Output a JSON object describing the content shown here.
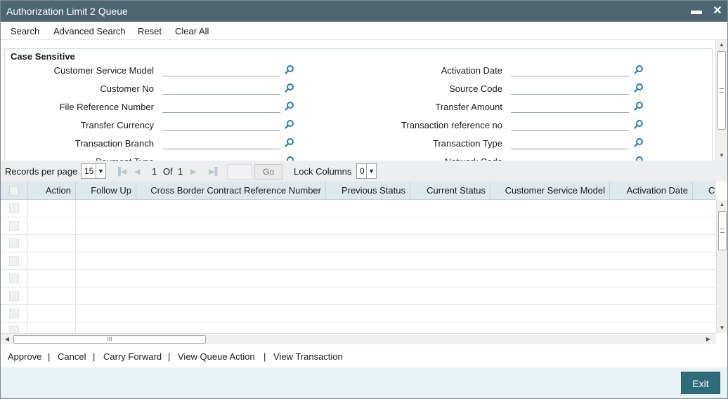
{
  "window": {
    "title": "Authorization Limit 2 Queue",
    "minimize_glyph": "▬",
    "close_glyph": "✕"
  },
  "toolbar": {
    "search": "Search",
    "advanced_search": "Advanced Search",
    "reset": "Reset",
    "clear_all": "Clear All"
  },
  "criteria": {
    "legend": "Case Sensitive",
    "left_fields": [
      {
        "label": "Customer Service Model",
        "value": ""
      },
      {
        "label": "Customer No",
        "value": ""
      },
      {
        "label": "File Reference Number",
        "value": ""
      },
      {
        "label": "Transfer Currency",
        "value": ""
      },
      {
        "label": "Transaction Branch",
        "value": ""
      },
      {
        "label": "Payment Type",
        "value": ""
      }
    ],
    "right_fields": [
      {
        "label": "Activation Date",
        "value": ""
      },
      {
        "label": "Source Code",
        "value": ""
      },
      {
        "label": "Transfer Amount",
        "value": ""
      },
      {
        "label": "Transaction reference no",
        "value": ""
      },
      {
        "label": "Transaction Type",
        "value": ""
      },
      {
        "label": "Network Code",
        "value": ""
      }
    ]
  },
  "pager": {
    "records_per_page_label": "Records per page",
    "records_per_page": "15",
    "current_page": "1",
    "of_label": "Of",
    "total_pages": "1",
    "go_label": "Go",
    "lock_columns_label": "Lock Columns",
    "lock_columns": "0"
  },
  "grid": {
    "columns": [
      "Action",
      "Follow Up",
      "Cross Border Contract Reference Number",
      "Previous Status",
      "Current Status",
      "Customer Service Model",
      "Activation Date",
      "C"
    ],
    "rows": [
      [],
      [],
      [],
      [],
      [],
      [],
      [],
      []
    ],
    "hscroll_grip": "III"
  },
  "actions": {
    "approve": "Approve",
    "cancel": "Cancel",
    "carry_forward": "Carry Forward",
    "view_queue_action": "View Queue Action",
    "view_transaction": "View Transaction",
    "separator": "|"
  },
  "footer": {
    "exit": "Exit"
  },
  "colors": {
    "titlebar": "#4c6672",
    "accent": "#2f6b78",
    "lookup_icon": "#1f7fb8",
    "header_bg": "#dfe8ec"
  }
}
